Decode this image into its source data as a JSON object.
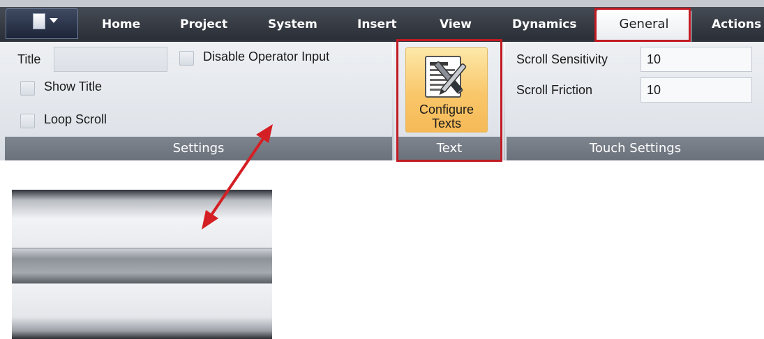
{
  "tabs": [
    {
      "label": "Home"
    },
    {
      "label": "Project"
    },
    {
      "label": "System"
    },
    {
      "label": "Insert"
    },
    {
      "label": "View"
    },
    {
      "label": "Dynamics"
    },
    {
      "label": "General",
      "active": true
    },
    {
      "label": "Actions"
    }
  ],
  "settings": {
    "title_label": "Title",
    "title_value": "",
    "disable_operator_input": "Disable Operator Input",
    "show_title": "Show Title",
    "loop_scroll": "Loop Scroll",
    "group_label": "Settings"
  },
  "text_group": {
    "button_line1": "Configure",
    "button_line2": "Texts",
    "group_label": "Text"
  },
  "touch": {
    "sensitivity_label": "Scroll Sensitivity",
    "sensitivity_value": "10",
    "friction_label": "Scroll Friction",
    "friction_value": "10",
    "group_label": "Touch Settings"
  },
  "colors": {
    "highlight": "#c21a22",
    "tab_bar": "#2c3038",
    "button_accent": "#f9c76a"
  }
}
